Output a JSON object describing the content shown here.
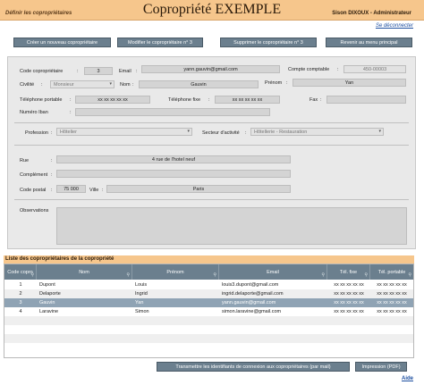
{
  "header": {
    "section_label": "Définir les copropriétaires",
    "title": "Copropriété EXEMPLE",
    "user": "Sison DIXOUX - Administrateur",
    "logout": "Se déconnecter"
  },
  "toolbar": {
    "create": "Créer un nouveau copropriétaire",
    "edit": "Modifier le copropriétaire n° 3",
    "delete": "Supprimer le copropriétaire n° 3",
    "back": "Revenir au menu principal"
  },
  "form": {
    "code_label": "Code copropriétaire",
    "code_value": "3",
    "email_label": "Email",
    "email_value": "yann.gauvin@gmail.com",
    "account_label": "Compte comptable",
    "account_value": "450-00003",
    "civility_label": "Civilité",
    "civility_value": "Monsieur",
    "name_label": "Nom",
    "name_value": "Gauvin",
    "firstname_label": "Prénom",
    "firstname_value": "Yan",
    "mobile_label": "Téléphone portable",
    "mobile_value": "xx xx xx xx xx",
    "phone_label": "Téléphone fixe",
    "phone_value": "xx xx xx xx xx",
    "fax_label": "Fax",
    "fax_value": "",
    "iban_label": "Numéro Iban",
    "iban_value": "",
    "profession_label": "Profession",
    "profession_value": "Hôtelier",
    "sector_label": "Secteur d'activité",
    "sector_value": "Hôtellerie - Restauration",
    "street_label": "Rue",
    "street_value": "4 rue de l'hotel neuf",
    "complement_label": "Complément",
    "complement_value": "",
    "zip_label": "Code postal",
    "zip_value": "75 000",
    "city_label": "Ville",
    "city_value": "Paris",
    "observations_label": "Observations",
    "observations_value": "",
    "colon": ":"
  },
  "list": {
    "title": "Liste des copropriétaires de la copropriété",
    "columns": [
      "Code copro",
      "Nom",
      "Prénom",
      "Email",
      "Tél. fixe",
      "Tél. portable"
    ],
    "rows": [
      [
        "1",
        "Dupont",
        "Louis",
        "louis3.dupont@gmail.com",
        "xx xx xx xx xx",
        "xx xx xx xx xx"
      ],
      [
        "2",
        "Delaporte",
        "Ingrid",
        "ingrid.delaporte@gmail.com",
        "xx xx xx xx xx",
        "xx xx xx xx xx"
      ],
      [
        "3",
        "Gauvin",
        "Yan",
        "yann.gauvin@gmail.com",
        "xx xx xx xx xx",
        "xx xx xx xx xx"
      ],
      [
        "4",
        "Laravine",
        "Simon",
        "simon.laravine@gmail.com",
        "xx xx xx xx xx",
        "xx xx xx xx xx"
      ]
    ],
    "selected_row": 2
  },
  "footer": {
    "transmit": "Transmettre les identifiants de connexion aux copropriétaires (par mail)",
    "print": "Impression (PDF)",
    "help": "Aide"
  },
  "icons": {
    "column_search": "magnifier-icon",
    "dropdown": "chevron-down-icon"
  }
}
